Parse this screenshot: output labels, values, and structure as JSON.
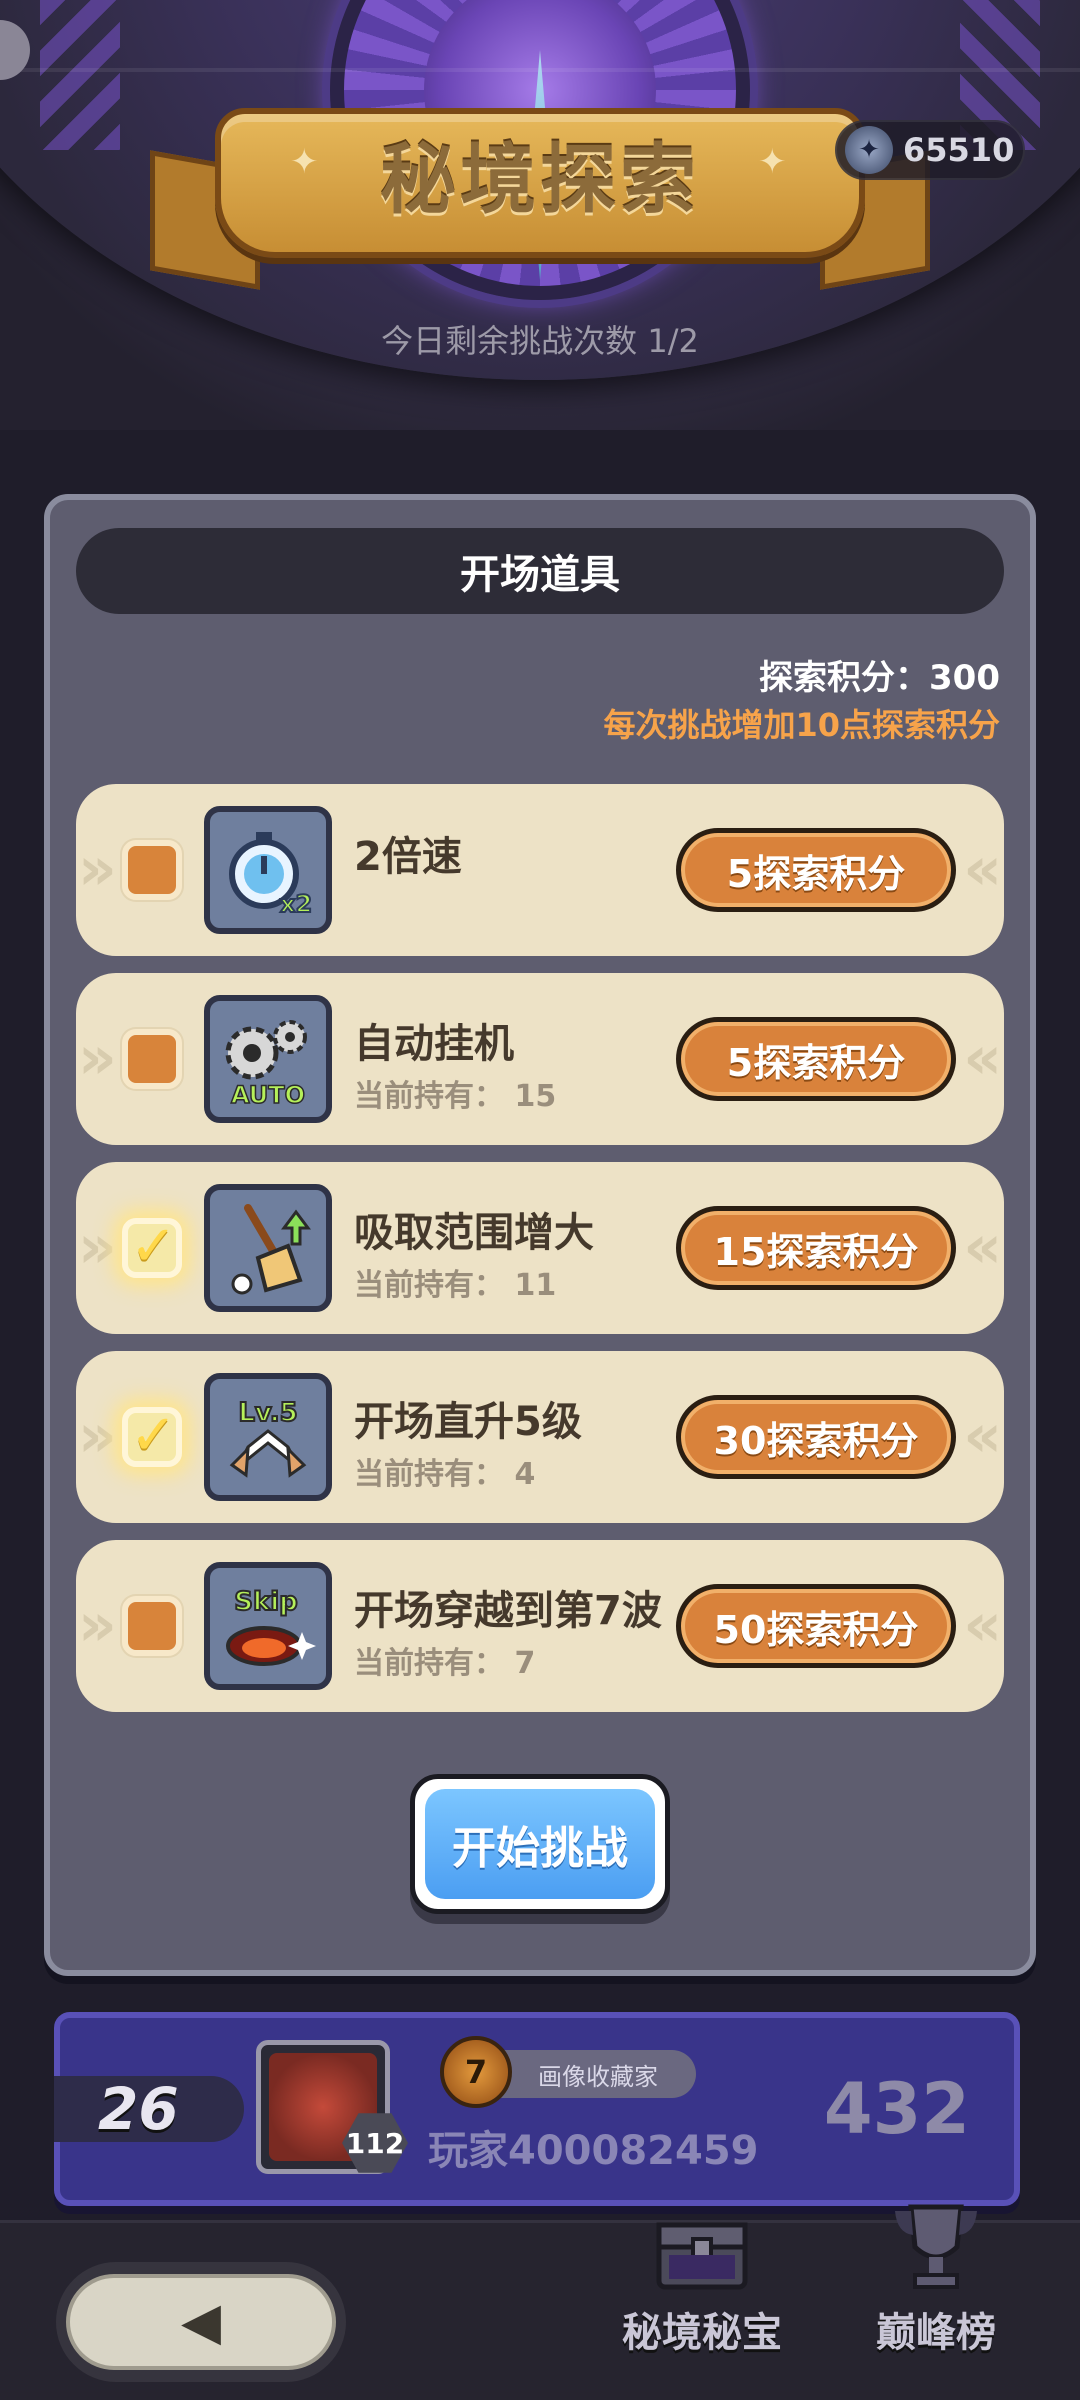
{
  "header": {
    "title": "秘境探索",
    "currency_value": "65510",
    "remaining_challenges": "今日剩余挑战次数 1/2"
  },
  "panel": {
    "title": "开场道具",
    "points_text": "探索积分：300",
    "points_note": "每次挑战增加10点探索积分",
    "items": [
      {
        "name": "2倍速",
        "held": "",
        "cost": "5探索积分",
        "checked": false,
        "icon": "speed-x2-icon"
      },
      {
        "name": "自动挂机",
        "held": "当前持有：  15",
        "cost": "5探索积分",
        "checked": false,
        "icon": "auto-gears-icon"
      },
      {
        "name": "吸取范围增大",
        "held": "当前持有：  11",
        "cost": "15探索积分",
        "checked": true,
        "icon": "broom-icon"
      },
      {
        "name": "开场直升5级",
        "held": "当前持有：  4",
        "cost": "30探索积分",
        "checked": true,
        "icon": "lv5-icon"
      },
      {
        "name": "开场穿越到第7波",
        "held": "当前持有：  7",
        "cost": "50探索积分",
        "checked": false,
        "icon": "skip-icon"
      }
    ],
    "start_button": "开始挑战"
  },
  "player": {
    "rank": "26",
    "level": "112",
    "title_level": "7",
    "title_tag": "画像收藏家",
    "name": "玩家400082459",
    "score": "432"
  },
  "nav": {
    "treasure_label": "秘境秘宝",
    "leaderboard_label": "巅峰榜"
  },
  "icon_labels": {
    "x2": "x2",
    "auto": "AUTO",
    "lv5": "Lv.5",
    "skip": "Skip"
  },
  "colors": {
    "accent_orange": "#d9823b",
    "start_blue": "#4b9ef2",
    "panel_bg": "#5e5d6f",
    "row_bg": "#ede2c6"
  }
}
